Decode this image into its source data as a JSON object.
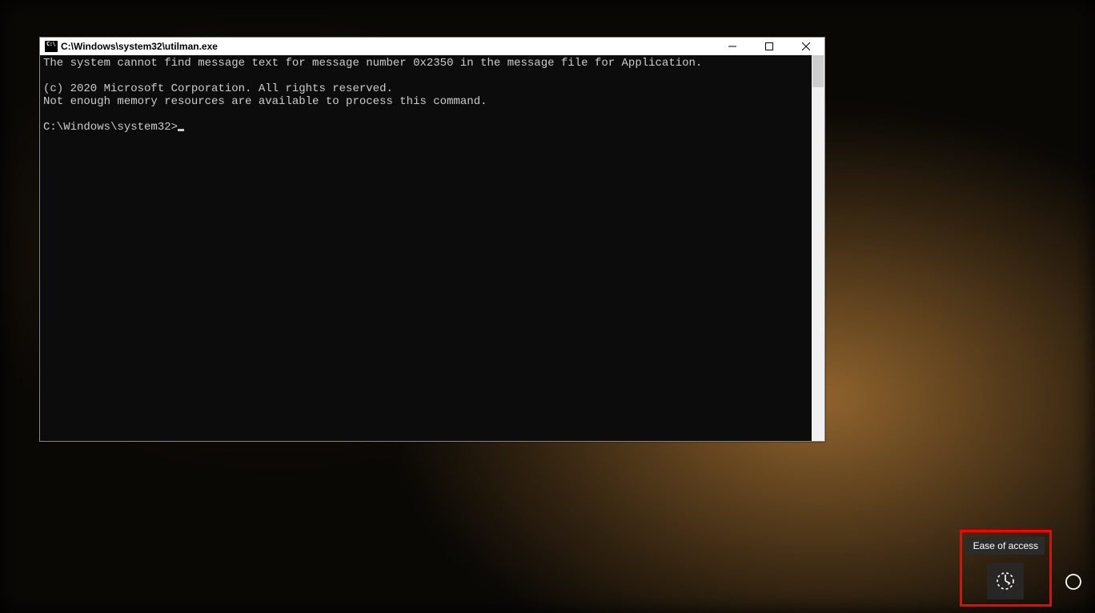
{
  "window": {
    "title": "C:\\Windows\\system32\\utilman.exe",
    "controls": {
      "minimize": "minimize",
      "maximize": "maximize",
      "close": "close"
    }
  },
  "console": {
    "line1": "The system cannot find message text for message number 0x2350 in the message file for Application.",
    "blank1": "",
    "line2": "(c) 2020 Microsoft Corporation. All rights reserved.",
    "line3": "Not enough memory resources are available to process this command.",
    "blank2": "",
    "prompt": "C:\\Windows\\system32>"
  },
  "corner": {
    "tooltip": "Ease of access",
    "ease_of_access": "ease-of-access",
    "power": "power"
  }
}
